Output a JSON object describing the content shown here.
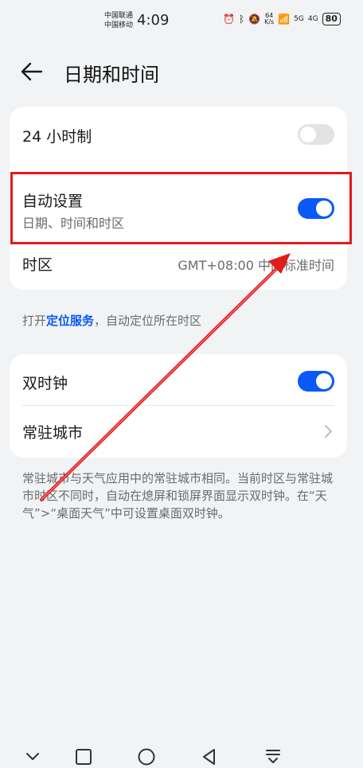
{
  "status_bar": {
    "carrier_1": "中国联通",
    "carrier_2": "中国移动",
    "time": "4:09",
    "net_speed_value": "64",
    "net_speed_unit": "K/s",
    "signal_1": "5G",
    "signal_2": "4G",
    "battery": "80"
  },
  "header": {
    "title": "日期和时间"
  },
  "card1": {
    "hour24": {
      "label": "24 小时制",
      "state": "off"
    },
    "auto": {
      "label": "自动设置",
      "sub": "日期、时间和时区",
      "state": "on"
    },
    "timezone": {
      "label": "时区",
      "value": "GMT+08:00 中国标准时间"
    }
  },
  "note1": {
    "prefix": "打开",
    "link": "定位服务",
    "suffix": "，自动定位所在时区"
  },
  "card2": {
    "dual_clock": {
      "label": "双时钟",
      "state": "on"
    },
    "home_city": {
      "label": "常驻城市"
    }
  },
  "note2": {
    "text": "常驻城市与天气应用中的常驻城市相同。当前时区与常驻城市时区不同时，自动在熄屏和锁屏界面显示双时钟。在“天气”>“桌面天气”中可设置桌面双时钟。"
  },
  "colors": {
    "accent": "#0a59f7",
    "annotation": "#e21b1b",
    "background": "#f1f3f5"
  }
}
